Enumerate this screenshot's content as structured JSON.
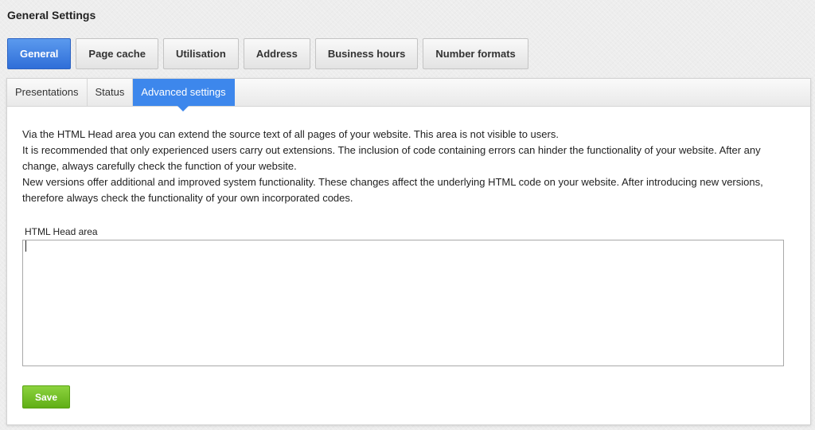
{
  "header": {
    "title": "General Settings"
  },
  "main_tabs": [
    {
      "label": "General",
      "active": true
    },
    {
      "label": "Page cache",
      "active": false
    },
    {
      "label": "Utilisation",
      "active": false
    },
    {
      "label": "Address",
      "active": false
    },
    {
      "label": "Business hours",
      "active": false
    },
    {
      "label": "Number formats",
      "active": false
    }
  ],
  "sub_tabs": [
    {
      "label": "Presentations",
      "active": false
    },
    {
      "label": "Status",
      "active": false
    },
    {
      "label": "Advanced settings",
      "active": true
    }
  ],
  "intro": {
    "lines": [
      "Via the HTML Head area you can extend the source text of all pages of your website. This area is not visible to users.",
      "It is recommended that only experienced users carry out extensions. The inclusion of code containing errors can hinder the functionality of your website. After any change, always carefully check the function of your website.",
      "New versions offer additional and improved system functionality. These changes affect the underlying HTML code on your website. After introducing new versions, therefore always check the functionality of your own incorporated codes."
    ]
  },
  "html_head": {
    "label": "HTML Head area",
    "value": ""
  },
  "actions": {
    "save_label": "Save"
  },
  "colors": {
    "accent_blue": "#3d87ec",
    "save_green": "#6cbb1f"
  }
}
